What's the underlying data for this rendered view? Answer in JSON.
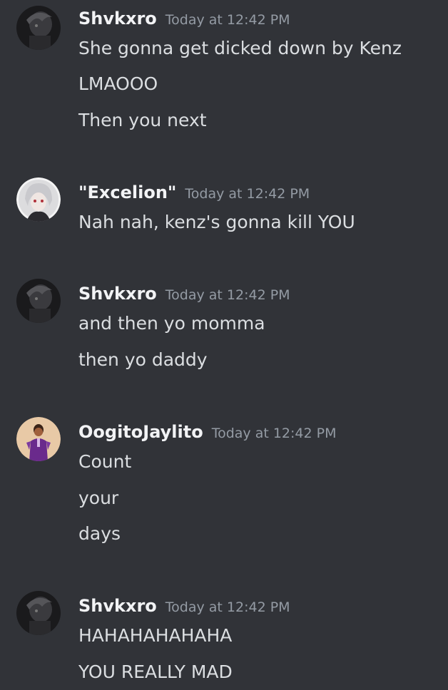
{
  "messages": [
    {
      "username": "Shvkxro",
      "timestamp": "Today at 12:42 PM",
      "avatar_icon": "dark-grayscale-avatar",
      "lines": [
        "She gonna get dicked down by Kenz",
        "LMAOOO",
        "Then you next"
      ]
    },
    {
      "username": "\"Excelion\"",
      "timestamp": "Today at 12:42 PM",
      "avatar_icon": "white-haired-anime-avatar",
      "lines": [
        "Nah nah, kenz's gonna kill YOU"
      ]
    },
    {
      "username": "Shvkxro",
      "timestamp": "Today at 12:42 PM",
      "avatar_icon": "dark-grayscale-avatar",
      "lines": [
        "and then yo momma",
        "then yo daddy"
      ]
    },
    {
      "username": "OogitoJaylito",
      "timestamp": "Today at 12:42 PM",
      "avatar_icon": "purple-suit-figure-avatar",
      "lines": [
        "Count",
        "your",
        "days"
      ]
    },
    {
      "username": "Shvkxro",
      "timestamp": "Today at 12:42 PM",
      "avatar_icon": "dark-grayscale-avatar",
      "lines": [
        "HAHAHAHAHAHA",
        "YOU REALLY MAD"
      ]
    }
  ],
  "colors": {
    "background": "#313338",
    "username": "#f2f3f5",
    "timestamp": "#949ba4",
    "message_text": "#dbdee1"
  }
}
